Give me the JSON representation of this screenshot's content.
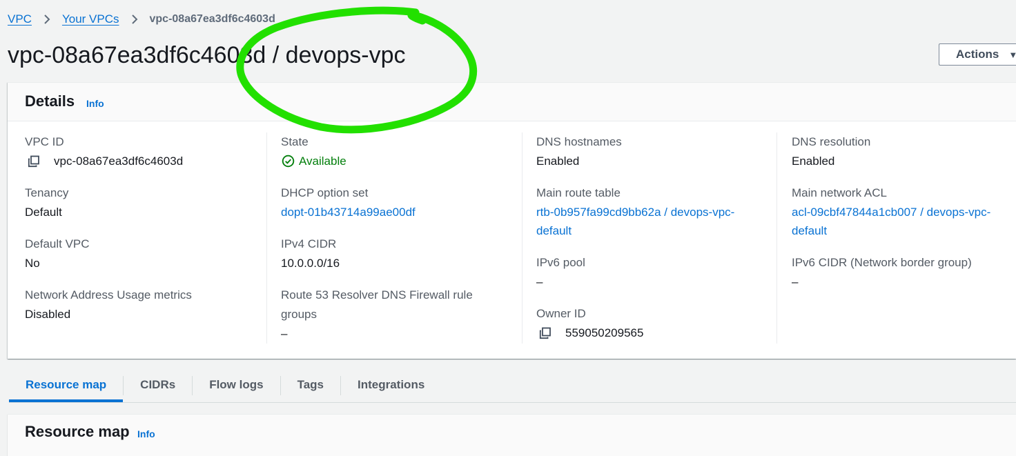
{
  "breadcrumb": {
    "items": [
      "VPC",
      "Your VPCs"
    ],
    "current": "vpc-08a67ea3df6c4603d"
  },
  "header": {
    "title": "vpc-08a67ea3df6c4603d / devops-vpc",
    "actions_label": "Actions"
  },
  "details": {
    "title": "Details",
    "info_label": "Info",
    "columns": [
      [
        {
          "label": "VPC ID",
          "value": "vpc-08a67ea3df6c4603d",
          "copy": true
        },
        {
          "label": "Tenancy",
          "value": "Default"
        },
        {
          "label": "Default VPC",
          "value": "No"
        },
        {
          "label": "Network Address Usage metrics",
          "value": "Disabled"
        }
      ],
      [
        {
          "label": "State",
          "value": "Available",
          "status": "success"
        },
        {
          "label": "DHCP option set",
          "value": "dopt-01b43714a99ae00df",
          "link": true
        },
        {
          "label": "IPv4 CIDR",
          "value": "10.0.0.0/16"
        },
        {
          "label": "Route 53 Resolver DNS Firewall rule groups",
          "value": "–"
        }
      ],
      [
        {
          "label": "DNS hostnames",
          "value": "Enabled"
        },
        {
          "label": "Main route table",
          "value": "rtb-0b957fa99cd9bb62a / devops-vpc-default",
          "link": true
        },
        {
          "label": "IPv6 pool",
          "value": "–"
        },
        {
          "label": "Owner ID",
          "value": "559050209565",
          "copy": true
        }
      ],
      [
        {
          "label": "DNS resolution",
          "value": "Enabled"
        },
        {
          "label": "Main network ACL",
          "value": "acl-09cbf47844a1cb007 / devops-vpc-default",
          "link": true
        },
        {
          "label": "IPv6 CIDR (Network border group)",
          "value": "–"
        }
      ]
    ]
  },
  "tabs": [
    {
      "label": "Resource map",
      "active": true
    },
    {
      "label": "CIDRs"
    },
    {
      "label": "Flow logs"
    },
    {
      "label": "Tags"
    },
    {
      "label": "Integrations"
    }
  ],
  "resource_map": {
    "title": "Resource map",
    "info_label": "Info"
  },
  "colors": {
    "link": "#0972d3",
    "success": "#037f0c",
    "annotation": "#22e000"
  },
  "icons": {
    "breadcrumb_separator": "chevron-right-icon",
    "copy": "copy-icon",
    "status": "status-success-icon",
    "dropdown": "caret-down-icon"
  }
}
